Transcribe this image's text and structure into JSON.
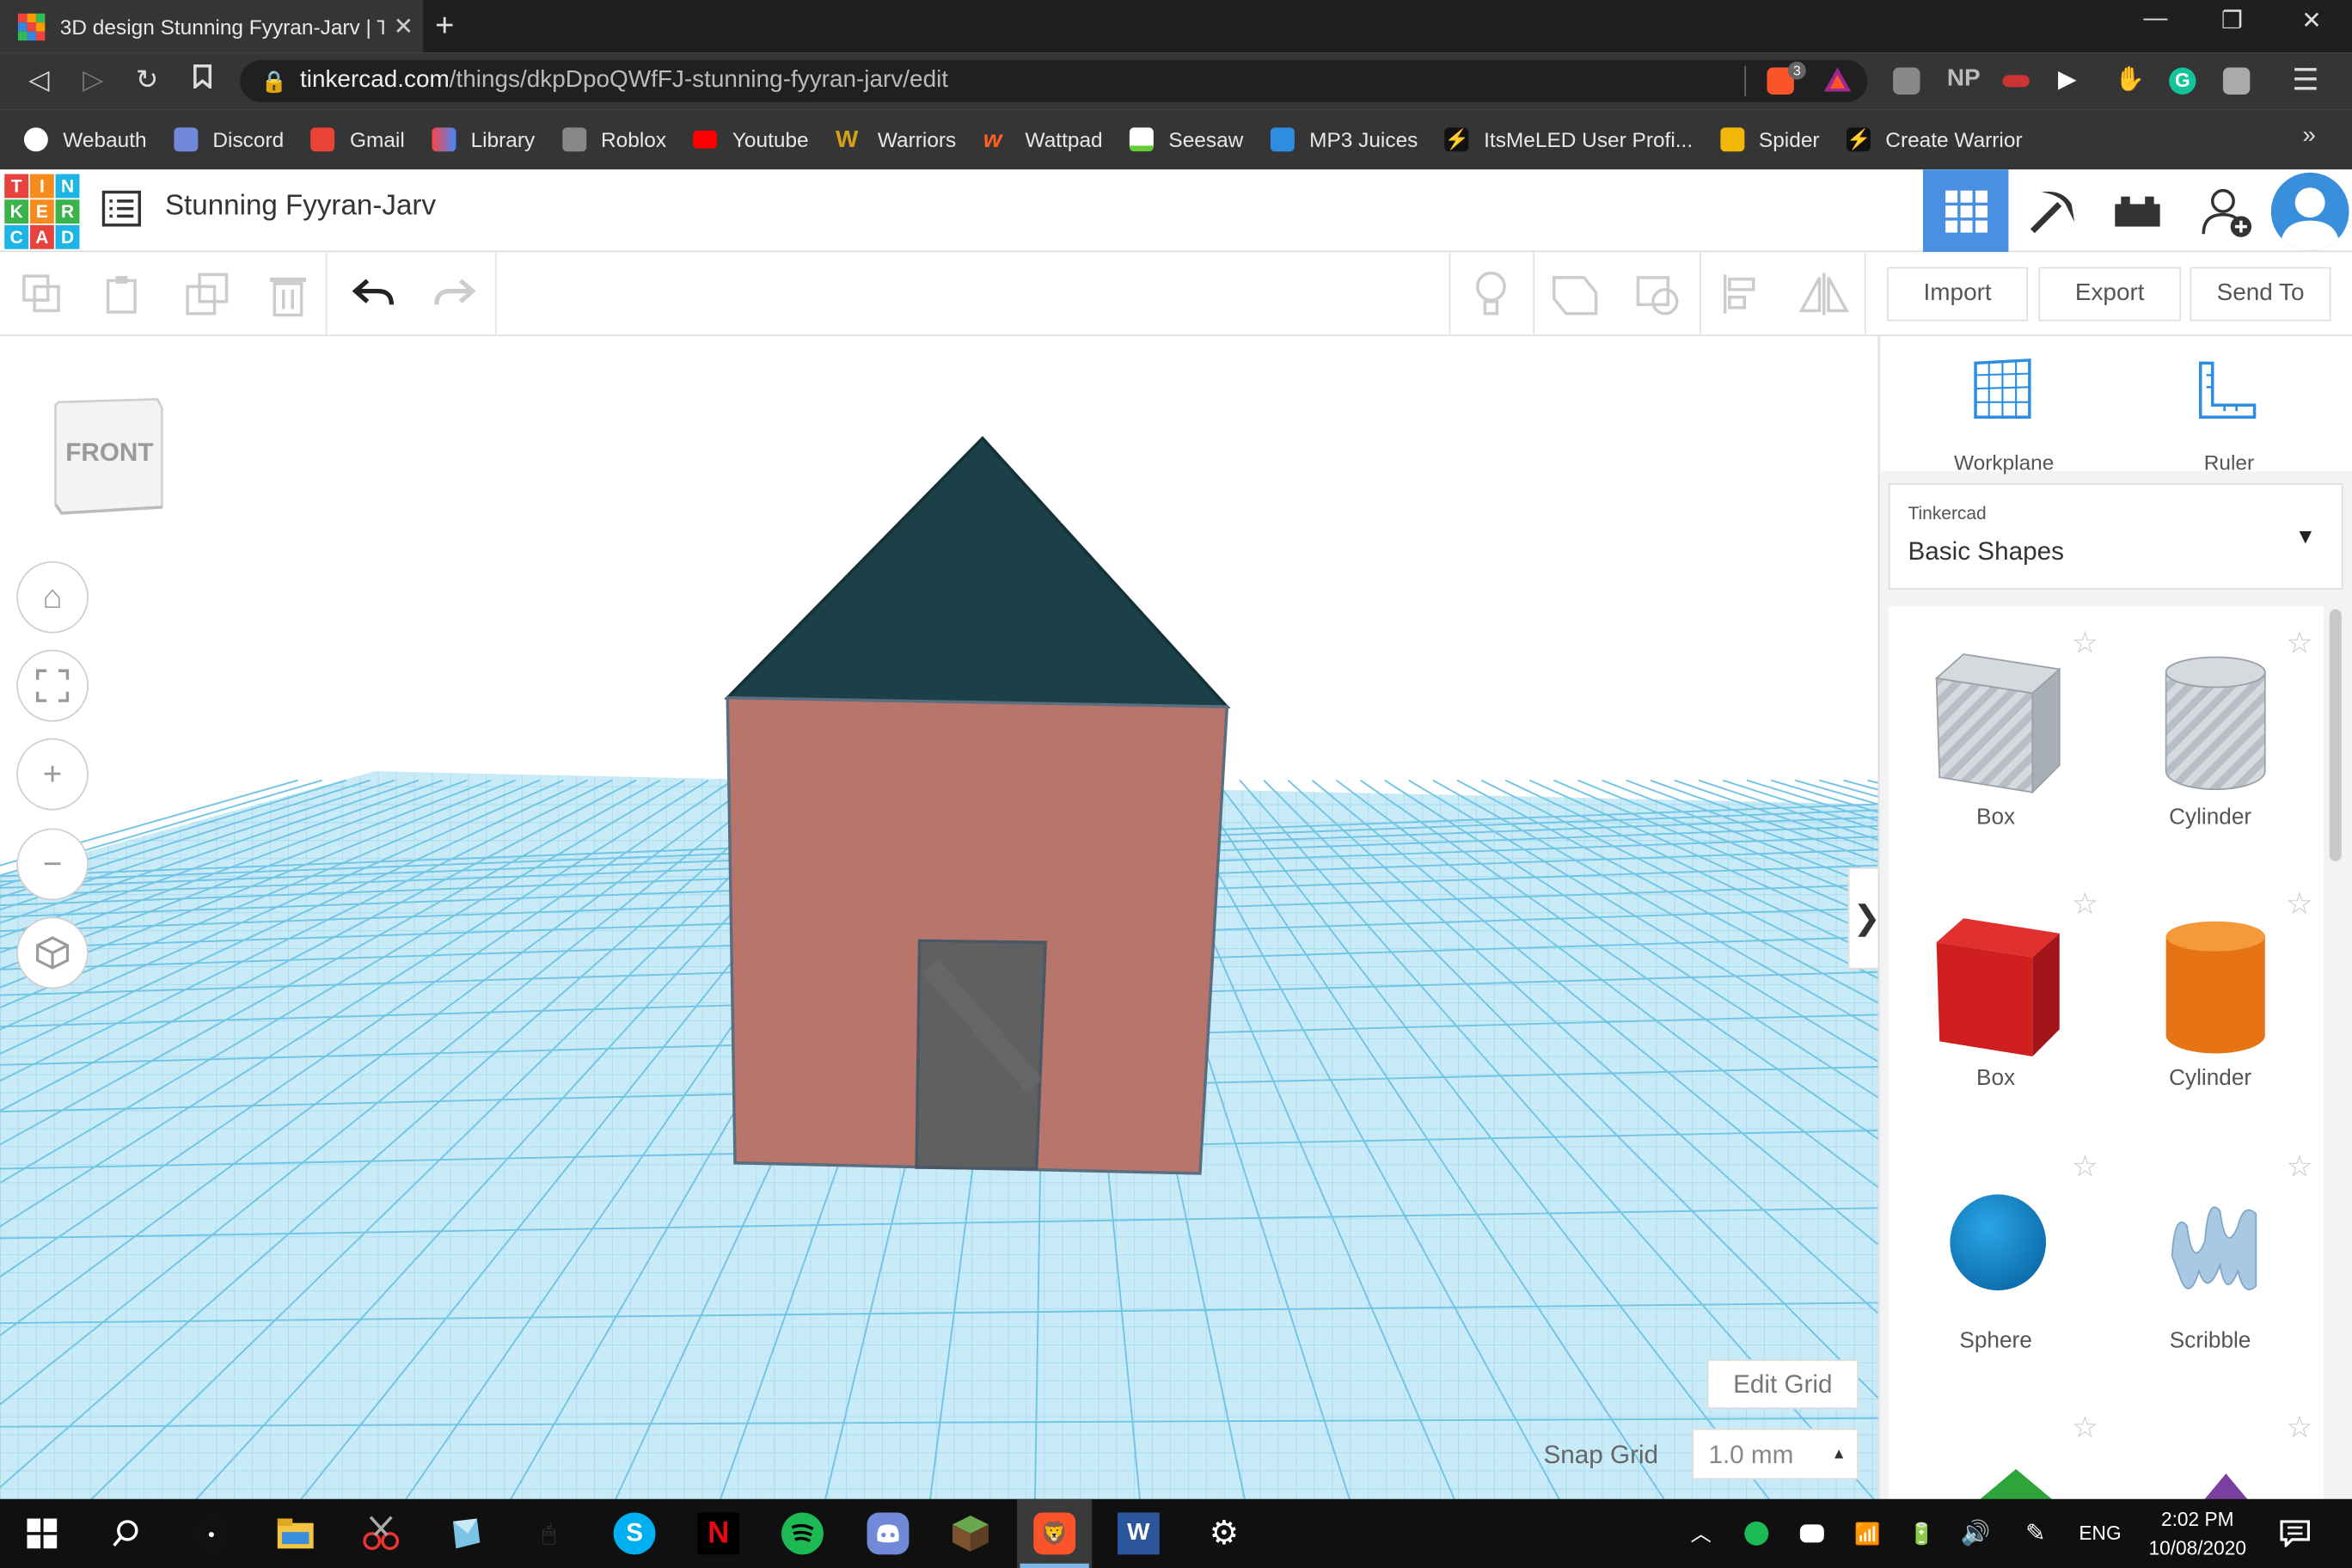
{
  "browser": {
    "tab_title": "3D design Stunning Fyyran-Jarv | T",
    "new_tab": "+",
    "url_domain": "tinkercad.com",
    "url_path": "/things/dkpDpoQWfFJ-stunning-fyyran-jarv/edit",
    "brave_badge": "3",
    "ext_np": "NP",
    "ext_grammarly": "G",
    "bookmarks": [
      "Webauth",
      "Discord",
      "Gmail",
      "Library",
      "Roblox",
      "Youtube",
      "Warriors",
      "Wattpad",
      "Seesaw",
      "MP3 Juices",
      "ItsMeLED User Profi...",
      "Spider",
      "Create Warrior"
    ],
    "more": "»"
  },
  "app": {
    "logo": [
      "T",
      "I",
      "N",
      "K",
      "E",
      "R",
      "C",
      "A",
      "D"
    ],
    "title": "Stunning Fyyran-Jarv",
    "colors": {
      "accent": "#3a8fdd",
      "grid_active": "#4a90e2"
    }
  },
  "toolbar": {
    "import": "Import",
    "export": "Export",
    "send_to": "Send To"
  },
  "viewport": {
    "view_cube": "FRONT",
    "edit_grid": "Edit Grid",
    "snap_grid_label": "Snap Grid",
    "snap_grid_value": "1.0 mm",
    "colors": {
      "roof": "#1b4048",
      "wall": "#b8756c",
      "door": "#606060",
      "grid": "#72c4e4"
    }
  },
  "panel": {
    "workplane": "Workplane",
    "ruler": "Ruler",
    "library_small": "Tinkercad",
    "library_name": "Basic Shapes",
    "shapes": [
      {
        "label": "Box",
        "icon": "box-hole-icon"
      },
      {
        "label": "Cylinder",
        "icon": "cylinder-hole-icon"
      },
      {
        "label": "Box",
        "icon": "box-red-icon"
      },
      {
        "label": "Cylinder",
        "icon": "cylinder-orange-icon"
      },
      {
        "label": "Sphere",
        "icon": "sphere-icon"
      },
      {
        "label": "Scribble",
        "icon": "scribble-icon"
      }
    ]
  },
  "taskbar": {
    "lang": "ENG",
    "time": "2:02 PM",
    "date": "10/08/2020"
  }
}
